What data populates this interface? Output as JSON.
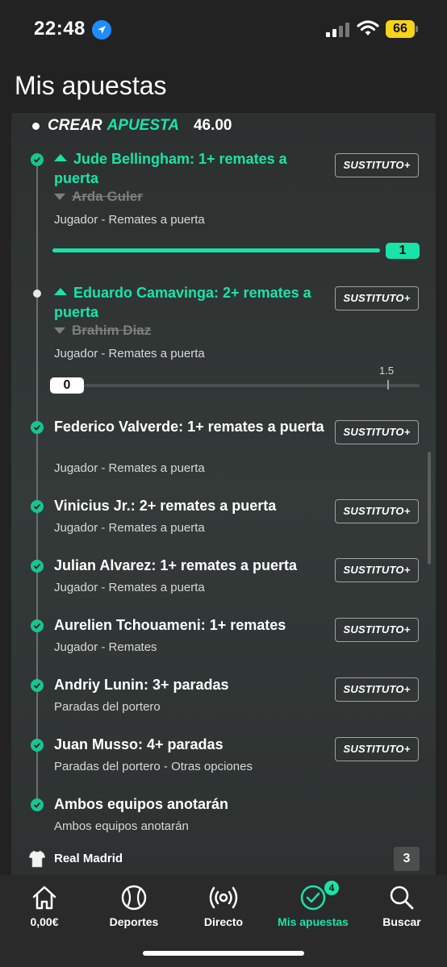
{
  "status": {
    "time": "22:48",
    "battery": "66"
  },
  "page": {
    "title": "Mis apuestas"
  },
  "bet": {
    "crear_part1": "CREAR",
    "crear_part2": "APUESTA",
    "odds": "46.00",
    "substitute_label": "SUSTITUTO+",
    "legs": [
      {
        "title": "Jude Bellingham: 1+ remates a puerta",
        "struck": "Arda Guler",
        "subtitle": "Jugador - Remates a puerta",
        "status": "won",
        "slider_value": "1",
        "progress": 1.0
      },
      {
        "title": "Eduardo Camavinga: 2+ remates a puerta",
        "struck": "Brahim Diaz",
        "subtitle": "Jugador - Remates a puerta",
        "status": "open",
        "slider_value": "0",
        "slider_target": "1.5",
        "progress": 0.0
      },
      {
        "title": "Federico Valverde: 1+ remates a puerta",
        "subtitle": "Jugador - Remates a puerta",
        "status": "won"
      },
      {
        "title": "Vinicius Jr.: 2+ remates a puerta",
        "subtitle": "Jugador - Remates a puerta",
        "status": "won"
      },
      {
        "title": "Julian Alvarez: 1+ remates a puerta",
        "subtitle": "Jugador - Remates a puerta",
        "status": "won"
      },
      {
        "title": "Aurelien Tchouameni: 1+ remates",
        "subtitle": "Jugador - Remates",
        "status": "won"
      },
      {
        "title": "Andriy Lunin: 3+ paradas",
        "subtitle": "Paradas del portero",
        "status": "won"
      },
      {
        "title": "Juan Musso: 4+ paradas",
        "subtitle": "Paradas del portero - Otras opciones",
        "status": "won"
      },
      {
        "title": "Ambos equipos anotarán",
        "subtitle": "Ambos equipos anotarán",
        "status": "won"
      }
    ],
    "team": {
      "name": "Real Madrid",
      "count": "3"
    }
  },
  "tabs": [
    {
      "label": "0,00€",
      "icon": "home-icon"
    },
    {
      "label": "Deportes",
      "icon": "ball-icon"
    },
    {
      "label": "Directo",
      "icon": "live-icon"
    },
    {
      "label": "Mis apuestas",
      "icon": "check-circle-icon",
      "badge": "4",
      "active": true
    },
    {
      "label": "Buscar",
      "icon": "search-icon"
    }
  ],
  "colors": {
    "accent": "#19e3a8",
    "background": "#222222",
    "panel": "#303534"
  }
}
